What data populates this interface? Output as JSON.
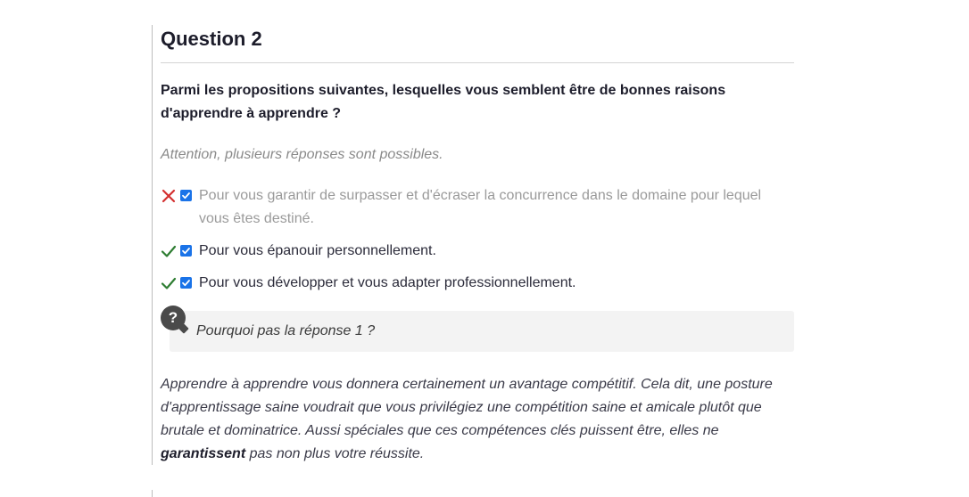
{
  "question": {
    "title": "Question 2",
    "prompt": "Parmi les propositions suivantes, lesquelles vous semblent être de bonnes raisons d'apprendre à apprendre ?",
    "note": "Attention, plusieurs réponses sont possibles."
  },
  "answers": [
    {
      "text": "Pour vous garantir de surpasser et d'écraser la concurrence dans le domaine pour lequel vous êtes destiné.",
      "checked": true,
      "result": "wrong"
    },
    {
      "text": "Pour vous épanouir personnellement.",
      "checked": true,
      "result": "correct"
    },
    {
      "text": "Pour vous développer et vous adapter professionnellement.",
      "checked": true,
      "result": "correct"
    }
  ],
  "feedback": {
    "icon": "question-mark-icon",
    "title": "Pourquoi pas la réponse 1 ?",
    "explanation_before": "Apprendre à apprendre vous donnera certainement un avantage compétitif. Cela dit, une posture d'apprentissage saine voudrait que vous privilégiez une compétition saine et amicale plutôt que brutale et dominatrice. Aussi spéciales que ces compétences clés puissent être, elles ne ",
    "explanation_bold": "garantissent",
    "explanation_after": " pas non plus votre réussite."
  },
  "colors": {
    "wrong": "#d32f2f",
    "correct": "#2e7d32",
    "checkbox": "#1a73e8"
  }
}
